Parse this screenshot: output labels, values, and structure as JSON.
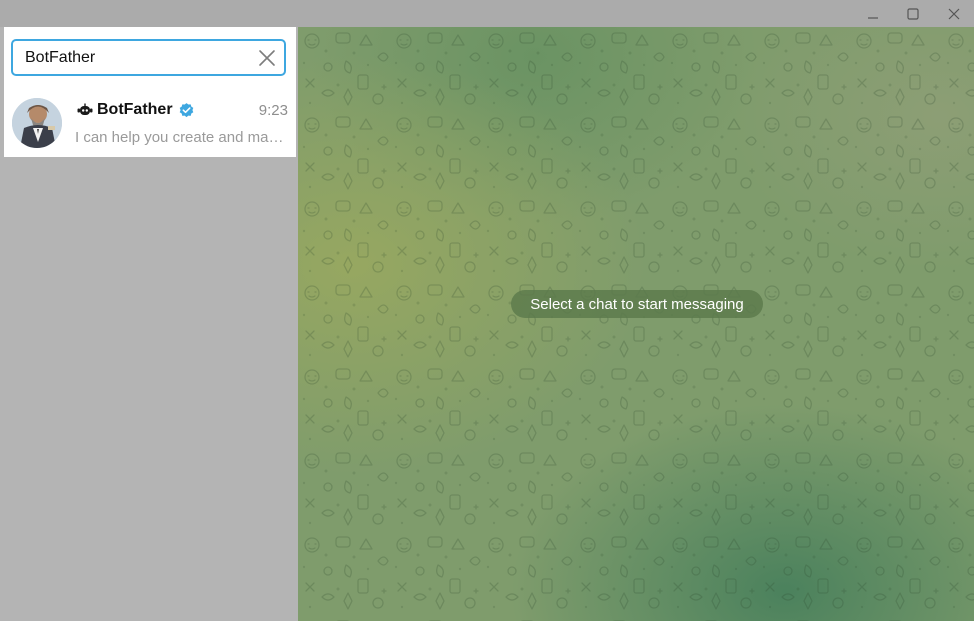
{
  "window": {
    "controls": [
      "minimize-icon",
      "maximize-icon",
      "close-icon"
    ]
  },
  "search": {
    "value": "BotFather",
    "clear_icon": "close-icon",
    "border_color": "#3ea7e0"
  },
  "results": [
    {
      "name": "BotFather",
      "time": "9:23",
      "preview": "I can help you create and manage Telegram bots.",
      "badge_icon": "bot-icon",
      "verified_icon": "verified-badge-icon",
      "verified_color": "#3ea7e0"
    }
  ],
  "chat_area": {
    "empty_message": "Select a chat to start messaging"
  }
}
